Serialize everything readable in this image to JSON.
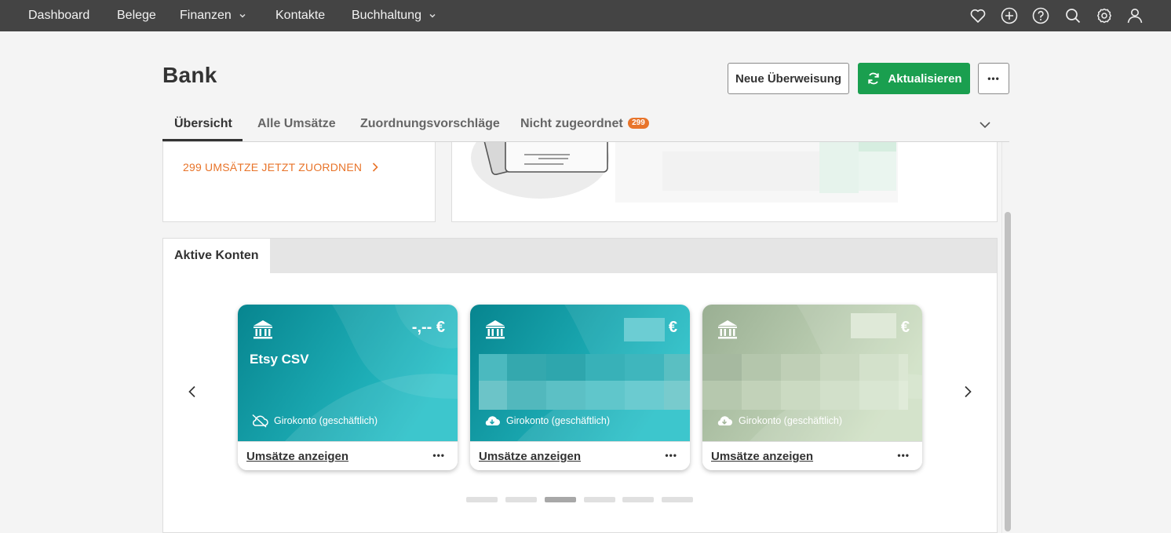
{
  "nav": {
    "items": [
      {
        "label": "Dashboard"
      },
      {
        "label": "Belege"
      },
      {
        "label": "Finanzen"
      },
      {
        "label": "Kontakte"
      },
      {
        "label": "Buchhaltung"
      }
    ],
    "icons": [
      "heart-icon",
      "plus-circle-icon",
      "help-icon",
      "search-icon",
      "settings-icon",
      "user-icon"
    ]
  },
  "page": {
    "title": "Bank"
  },
  "actions": {
    "new_transfer": "Neue Überweisung",
    "refresh": "Aktualisieren",
    "more": "•••"
  },
  "tabs": [
    {
      "label": "Übersicht",
      "active": true
    },
    {
      "label": "Alle Umsätze"
    },
    {
      "label": "Zuordnungsvorschläge"
    },
    {
      "label": "Nicht zugeordnet",
      "badge": "299"
    }
  ],
  "summary": {
    "assign_link": "299 UMSÄTZE JETZT ZUORDNEN"
  },
  "accounts_panel": {
    "tab_label": "Aktive Konten",
    "accounts": [
      {
        "name": "Etsy CSV",
        "balance": "-,-- €",
        "type": "Girokonto (geschäftlich)",
        "show_label": "Umsätze anzeigen",
        "more": "•••",
        "sync": "cloud-off-icon"
      },
      {
        "name": "",
        "balance": "€",
        "type": "Girokonto (geschäftlich)",
        "show_label": "Umsätze anzeigen",
        "more": "•••",
        "sync": "cloud-download-icon"
      },
      {
        "name": "",
        "balance": "€",
        "type": "Girokonto (geschäftlich)",
        "show_label": "Umsätze anzeigen",
        "more": "•••",
        "sync": "cloud-download-icon"
      }
    ],
    "pagination": {
      "pages": 6,
      "active_index": 2
    }
  },
  "colors": {
    "nav_bg": "#444444",
    "primary": "#1a9f4f",
    "accent": "#e8742a",
    "card_teal": "#13a7b0",
    "card_sage": "#b5c8a8"
  }
}
